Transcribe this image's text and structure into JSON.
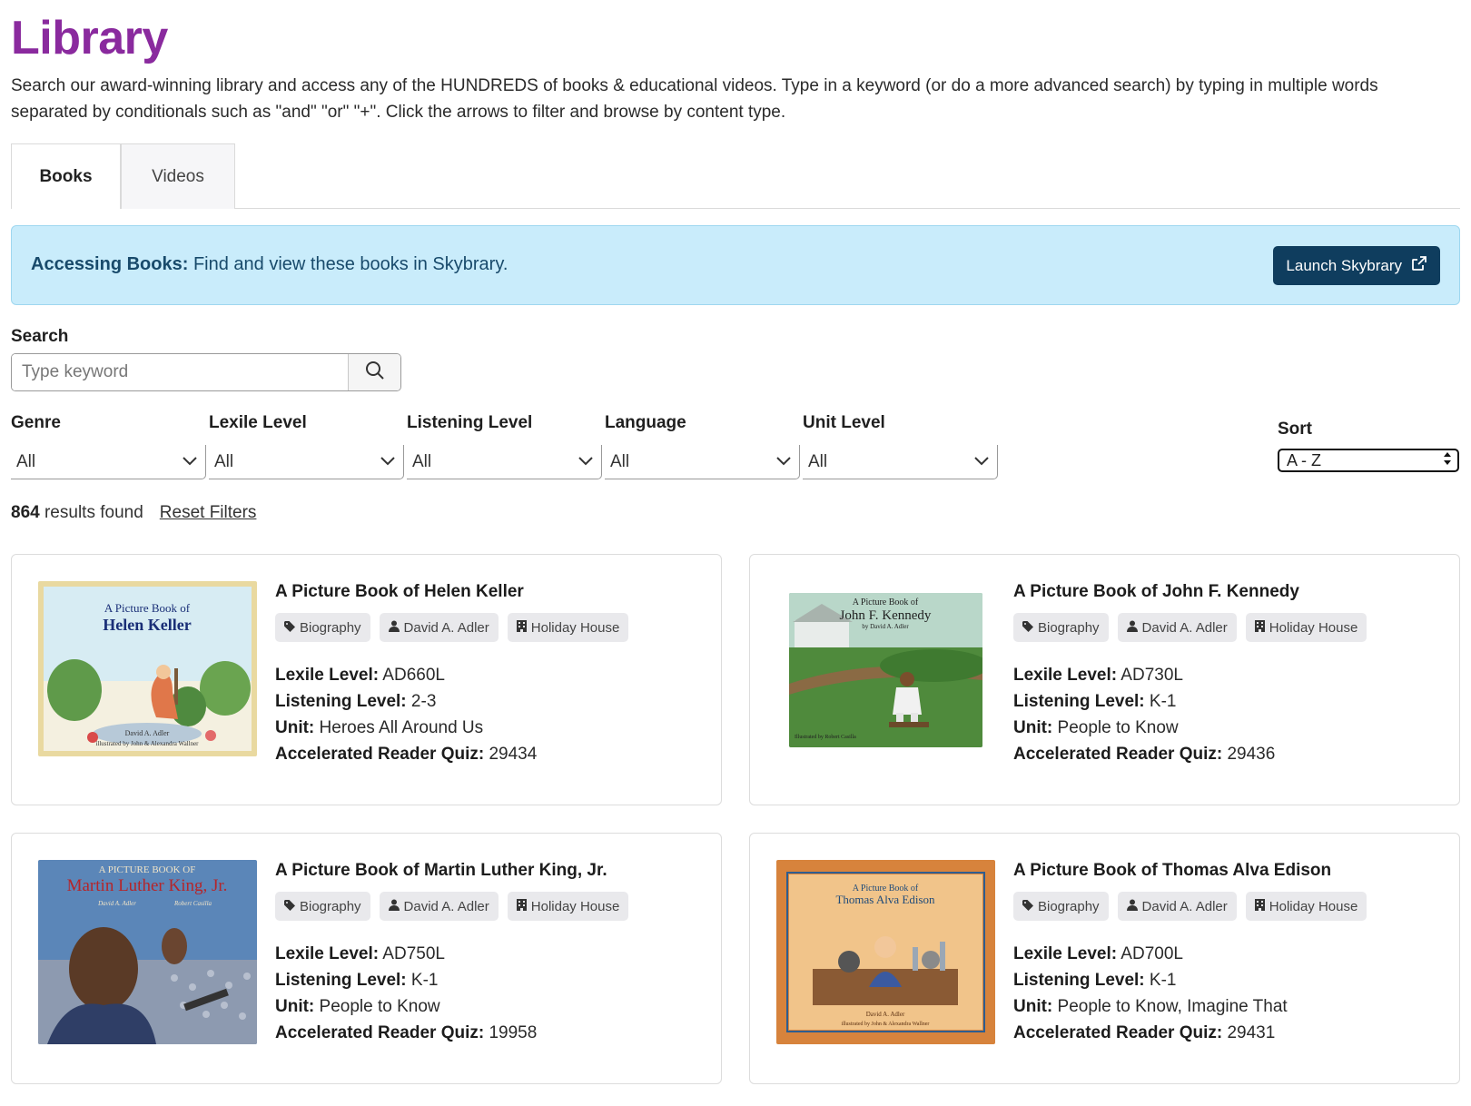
{
  "page": {
    "title": "Library",
    "intro": "Search our award-winning library and access any of the HUNDREDS of books & educational videos. Type in a keyword (or do a more advanced search) by typing in multiple words separated by conditionals such as \"and\" \"or\" \"+\". Click the arrows to filter and browse by content type."
  },
  "tabs": [
    {
      "label": "Books",
      "active": true
    },
    {
      "label": "Videos",
      "active": false
    }
  ],
  "notice": {
    "bold": "Accessing Books:",
    "text": " Find and view these books in Skybrary.",
    "button_label": "Launch Skybrary",
    "button_icon": "external-link-icon",
    "bg_color": "#c9ecfb",
    "button_color": "#0f3d5e"
  },
  "search": {
    "label": "Search",
    "placeholder": "Type keyword",
    "value": "",
    "icon": "search-icon"
  },
  "filters": [
    {
      "label": "Genre",
      "value": "All"
    },
    {
      "label": "Lexile Level",
      "value": "All"
    },
    {
      "label": "Listening Level",
      "value": "All"
    },
    {
      "label": "Language",
      "value": "All"
    },
    {
      "label": "Unit Level",
      "value": "All"
    }
  ],
  "sort": {
    "label": "Sort",
    "value": "A - Z"
  },
  "results": {
    "count": "864",
    "suffix": "results found",
    "reset_label": "Reset Filters"
  },
  "labels": {
    "lexile": "Lexile Level:",
    "listening": "Listening Level:",
    "unit": "Unit:",
    "ar_quiz": "Accelerated Reader Quiz:"
  },
  "books": [
    {
      "title": "A Picture Book of Helen Keller",
      "genre": "Biography",
      "author": "David A. Adler",
      "publisher": "Holiday House",
      "lexile": "AD660L",
      "listening": "2-3",
      "unit": "Heroes All Around Us",
      "ar_quiz": "29434",
      "cover": {
        "line1": "A Picture Book of",
        "line2": "Helen Keller",
        "byline": "David A. Adler",
        "illustrator": "illustrated by John & Alexandra Wallner"
      }
    },
    {
      "title": "A Picture Book of John F. Kennedy",
      "genre": "Biography",
      "author": "David A. Adler",
      "publisher": "Holiday House",
      "lexile": "AD730L",
      "listening": "K-1",
      "unit": "People to Know",
      "ar_quiz": "29436",
      "cover": {
        "line1": "A Picture Book of",
        "line2": "John F. Kennedy",
        "byline": "by David A. Adler",
        "illustrator": "Illustrated by Robert Casilla"
      }
    },
    {
      "title": "A Picture Book of Martin Luther King, Jr.",
      "genre": "Biography",
      "author": "David A. Adler",
      "publisher": "Holiday House",
      "lexile": "AD750L",
      "listening": "K-1",
      "unit": "People to Know",
      "ar_quiz": "19958",
      "cover": {
        "line1": "A PICTURE BOOK OF",
        "line2": "Martin Luther King, Jr.",
        "byline": "David A. Adler",
        "illustrator": "Robert Casilla"
      }
    },
    {
      "title": "A Picture Book of Thomas Alva Edison",
      "genre": "Biography",
      "author": "David A. Adler",
      "publisher": "Holiday House",
      "lexile": "AD700L",
      "listening": "K-1",
      "unit": "People to Know, Imagine That",
      "ar_quiz": "29431",
      "cover": {
        "line1": "A Picture Book of",
        "line2": "Thomas Alva Edison",
        "byline": "David A. Adler",
        "illustrator": "illustrated by John & Alexandra Wallner"
      }
    }
  ],
  "colors": {
    "title": "#8a2a9e",
    "tag_bg": "#e9e9ec"
  }
}
